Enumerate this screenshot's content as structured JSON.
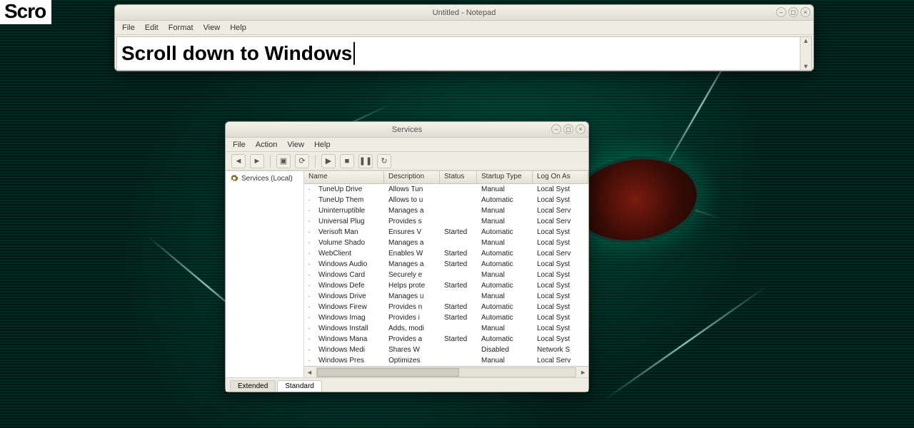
{
  "corner_label": "Scro",
  "notepad": {
    "title": "Untitled - Notepad",
    "menu": [
      "File",
      "Edit",
      "Format",
      "View",
      "Help"
    ],
    "content": "Scroll down to Windows"
  },
  "services": {
    "title": "Services",
    "menu": [
      "File",
      "Action",
      "View",
      "Help"
    ],
    "tree_root": "Services (Local)",
    "columns": [
      "Name",
      "Description",
      "Status",
      "Startup Type",
      "Log On As"
    ],
    "tabs": [
      "Extended",
      "Standard"
    ],
    "rows": [
      {
        "name": "TuneUp Drive",
        "desc": "Allows Tun",
        "status": "",
        "type": "Manual",
        "logon": "Local Syst"
      },
      {
        "name": "TuneUp Them",
        "desc": "Allows to u",
        "status": "",
        "type": "Automatic",
        "logon": "Local Syst"
      },
      {
        "name": "Uninterruptible",
        "desc": "Manages a",
        "status": "",
        "type": "Manual",
        "logon": "Local Serv"
      },
      {
        "name": "Universal Plug",
        "desc": "Provides s",
        "status": "",
        "type": "Manual",
        "logon": "Local Serv"
      },
      {
        "name": "Verisoft Man",
        "desc": "Ensures V",
        "status": "Started",
        "type": "Automatic",
        "logon": "Local Syst"
      },
      {
        "name": "Volume Shado",
        "desc": "Manages a",
        "status": "",
        "type": "Manual",
        "logon": "Local Syst"
      },
      {
        "name": "WebClient",
        "desc": "Enables W",
        "status": "Started",
        "type": "Automatic",
        "logon": "Local Serv"
      },
      {
        "name": "Windows Audio",
        "desc": "Manages a",
        "status": "Started",
        "type": "Automatic",
        "logon": "Local Syst"
      },
      {
        "name": "Windows Card",
        "desc": "Securely e",
        "status": "",
        "type": "Manual",
        "logon": "Local Syst"
      },
      {
        "name": "Windows Defe",
        "desc": "Helps prote",
        "status": "Started",
        "type": "Automatic",
        "logon": "Local Syst"
      },
      {
        "name": "Windows Drive",
        "desc": "Manages u",
        "status": "",
        "type": "Manual",
        "logon": "Local Syst"
      },
      {
        "name": "Windows Firew",
        "desc": "Provides n",
        "status": "Started",
        "type": "Automatic",
        "logon": "Local Syst"
      },
      {
        "name": "Windows Imag",
        "desc": "Provides i",
        "status": "Started",
        "type": "Automatic",
        "logon": "Local Syst"
      },
      {
        "name": "Windows Install",
        "desc": "Adds, modi",
        "status": "",
        "type": "Manual",
        "logon": "Local Syst"
      },
      {
        "name": "Windows Mana",
        "desc": "Provides a",
        "status": "Started",
        "type": "Automatic",
        "logon": "Local Syst"
      },
      {
        "name": "Windows Medi",
        "desc": "Shares W",
        "status": "",
        "type": "Disabled",
        "logon": "Network S"
      },
      {
        "name": "Windows Pres",
        "desc": "Optimizes",
        "status": "",
        "type": "Manual",
        "logon": "Local Serv"
      }
    ]
  }
}
